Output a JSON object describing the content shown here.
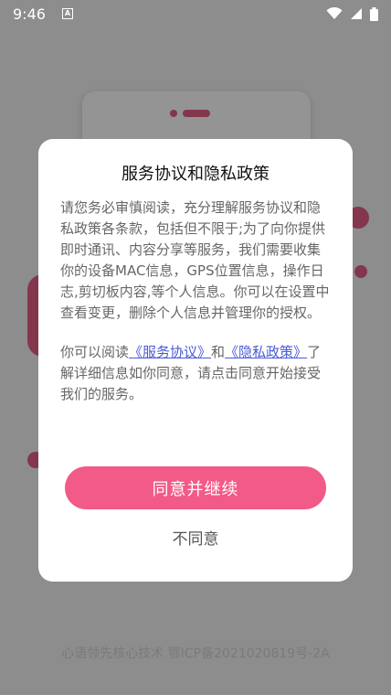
{
  "status_bar": {
    "time": "9:46",
    "notification_glyph": "A",
    "icons": [
      "wifi-icon",
      "signal-icon",
      "battery-icon"
    ]
  },
  "dialog": {
    "title": "服务协议和隐私政策",
    "paragraph1": "请您务必审慎阅读，充分理解服务协议和隐私政策各条款，包括但不限于;为了向你提供即时通讯、内容分享等服务，我们需要收集你的设备MAC信息，GPS位置信息，操作日志,剪切板内容,等个人信息。你可以在设置中查看变更，删除个人信息并管理你的授权。",
    "paragraph2_prefix": "你可以阅读",
    "service_link": "《服务协议》",
    "paragraph2_and": "和",
    "privacy_link": "《隐私政策》",
    "paragraph2_suffix": "了解详细信息如你同意，请点击同意开始接受我们的服务。",
    "agree_label": "同意并继续",
    "disagree_label": "不同意"
  },
  "footer": {
    "text": "心语领先核心技术 鄂ICP备2021020819号-2A"
  },
  "colors": {
    "accent": "#f25a87",
    "link": "#4a5ad6"
  }
}
